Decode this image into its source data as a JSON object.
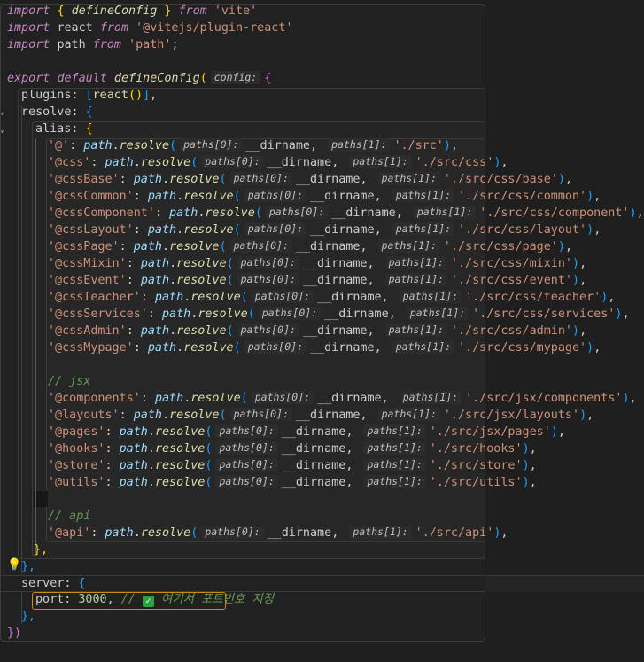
{
  "editor": {
    "file_lines": {
      "l1": {
        "kw": "import",
        "a": "{",
        "b": "defineConfig",
        "c": "}",
        "from": "from",
        "src": "'vite'"
      },
      "l2": {
        "kw": "import",
        "name": "react",
        "from": "from",
        "src": "'@vitejs/plugin-react'"
      },
      "l3": {
        "kw": "import",
        "name": "path",
        "from": "from",
        "src": "'path'",
        "end": ";"
      },
      "l4": {
        "kw": "export",
        "def": "default",
        "fn": "defineConfig",
        "paren": "(",
        "hint": "config:",
        "br": "{"
      },
      "l5": {
        "prop": "plugins",
        "colon": ":",
        "open": "[",
        "fn": "react",
        "call": "()",
        "close": "]",
        "comma": ","
      },
      "l6": {
        "prop": "resolve",
        "colon": ":",
        "br": "{"
      },
      "l7": {
        "prop": "alias",
        "colon": ":",
        "br": "{"
      }
    },
    "hints": {
      "p0": "paths[0]:",
      "p1": "paths[1]:"
    },
    "dirname": "__dirname",
    "resolve_obj": "path",
    "resolve_fn": "resolve",
    "aliases_css": [
      {
        "key": "'@'",
        "val": "'./src'"
      },
      {
        "key": "'@css'",
        "val": "'./src/css'"
      },
      {
        "key": "'@cssBase'",
        "val": "'./src/css/base'"
      },
      {
        "key": "'@cssCommon'",
        "val": "'./src/css/common'"
      },
      {
        "key": "'@cssComponent'",
        "val": "'./src/css/component'"
      },
      {
        "key": "'@cssLayout'",
        "val": "'./src/css/layout'"
      },
      {
        "key": "'@cssPage'",
        "val": "'./src/css/page'"
      },
      {
        "key": "'@cssMixin'",
        "val": "'./src/css/mixin'"
      },
      {
        "key": "'@cssEvent'",
        "val": "'./src/css/event'"
      },
      {
        "key": "'@cssTeacher'",
        "val": "'./src/css/teacher'"
      },
      {
        "key": "'@cssServices'",
        "val": "'./src/css/services'"
      },
      {
        "key": "'@cssAdmin'",
        "val": "'./src/css/admin'"
      },
      {
        "key": "'@cssMypage'",
        "val": "'./src/css/mypage'"
      }
    ],
    "comment_jsx": "// jsx",
    "aliases_jsx": [
      {
        "key": "'@components'",
        "val": "'./src/jsx/components'"
      },
      {
        "key": "'@layouts'",
        "val": "'./src/jsx/layouts'"
      },
      {
        "key": "'@pages'",
        "val": "'./src/jsx/pages'"
      },
      {
        "key": "'@hooks'",
        "val": "'./src/hooks'"
      },
      {
        "key": "'@store'",
        "val": "'./src/store'"
      },
      {
        "key": "'@utils'",
        "val": "'./src/utils'"
      }
    ],
    "comment_api": "// api",
    "aliases_api": [
      {
        "key": "'@api'",
        "val": "'./src/api'"
      }
    ],
    "close_alias": "},",
    "close_resolve": "},",
    "server_prop": "server",
    "server_open": "{",
    "port_prop": "port",
    "port_value": "3000",
    "port_comment_prefix": "//",
    "port_comment_text": "여기서 포트번호 지정",
    "close_server": "},",
    "close_config": "})",
    "icons": {
      "bulb": "lightbulb-icon",
      "check": "check-mark-icon"
    },
    "colors": {
      "background": "#1f1f1f",
      "highlight_box": "#d18616",
      "check": "#2ea043"
    }
  }
}
